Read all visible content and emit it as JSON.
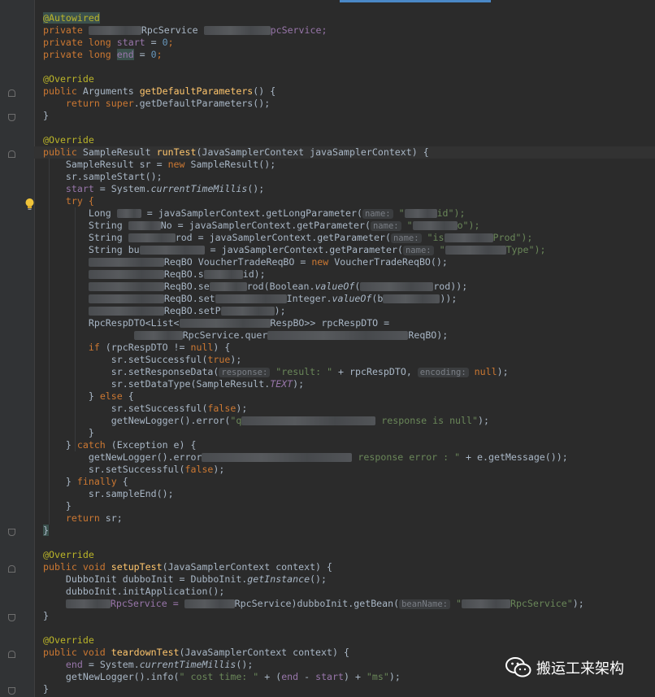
{
  "editor": {
    "background": "#2b2b2b",
    "gutter_bg": "#313335",
    "accent": "#4a88c7"
  },
  "code": {
    "l1": "@Autowired",
    "l2a": "private ",
    "l2b": "RpcService ",
    "l2c": "pcService;",
    "l3a": "private long ",
    "l3b": "start",
    "l3c": " = ",
    "l3d": "0",
    "l3e": ";",
    "l4a": "private long ",
    "l4b": "end",
    "l4c": " = ",
    "l4d": "0",
    "l4e": ";",
    "l6": "@Override",
    "l7a": "public ",
    "l7b": "Arguments ",
    "l7c": "getDefaultParameters",
    "l7d": "() {",
    "l8a": "return super",
    "l8b": ".getDefaultParameters();",
    "l9": "}",
    "l11": "@Override",
    "l12a": "public ",
    "l12b": "SampleResult ",
    "l12c": "runTest",
    "l12d": "(JavaSamplerContext javaSamplerContext) {",
    "l13a": "SampleResult sr = ",
    "l13b": "new ",
    "l13c": "SampleResult();",
    "l14": "sr.sampleStart();",
    "l15a": "start",
    "l15b": " = System.",
    "l15c": "currentTimeMillis",
    "l15d": "();",
    "l16": "try {",
    "l17a": "Long ",
    "l17b": " = javaSamplerContext.getLongParameter(",
    "l17h": "name:",
    "l17c": " \"",
    "l17d": "id\");",
    "l18a": "String ",
    "l18b": "No = javaSamplerContext.getParameter(",
    "l18h": "name:",
    "l18c": " \"",
    "l18d": "o\");",
    "l19a": "String ",
    "l19b": "rod = javaSamplerContext.getParameter(",
    "l19h": "name:",
    "l19c": " \"is",
    "l19d": "Prod\");",
    "l20a": "String bu",
    "l20b": " = javaSamplerContext.getParameter(",
    "l20h": "name:",
    "l20c": " \"",
    "l20d": "Type\");",
    "l21a": "ReqBO VoucherTradeReqBO = ",
    "l21b": "new ",
    "l21c": "VoucherTradeReqBO();",
    "l22a": "ReqBO.s",
    "l22b": "id);",
    "l23a": "ReqBO.se",
    "l23b": "rod(Boolean.",
    "l23c": "valueOf",
    "l23d": "(",
    "l23e": "rod));",
    "l24a": "ReqBO.set",
    "l24b": "Integer.",
    "l24c": "valueOf",
    "l24d": "(b",
    "l24e": "));",
    "l25a": "ReqBO.setP",
    "l25b": ");",
    "l26a": "RpcRespDTO<List<",
    "l26b": "RespBO>> rpcRespDTO =",
    "l27a": "RpcService.quer",
    "l27b": "ReqBO);",
    "l28a": "if ",
    "l28b": "(rpcRespDTO != ",
    "l28c": "null",
    "l28d": ") {",
    "l29a": "sr.setSuccessful(",
    "l29b": "true",
    "l29c": ");",
    "l30a": "sr.setResponseData(",
    "l30h": "response:",
    "l30b": " \"result: \"",
    "l30c": " + rpcRespDTO, ",
    "l30h2": "encoding:",
    "l30d": " null",
    "l30e": ");",
    "l31a": "sr.setDataType(SampleResult.",
    "l31b": "TEXT",
    "l31c": ");",
    "l32a": "} ",
    "l32b": "else ",
    "l32c": "{",
    "l33a": "sr.setSuccessful(",
    "l33b": "false",
    "l33c": ");",
    "l34a": "getNewLogger().error(",
    "l34b": "\"q",
    "l34c": " response is null\"",
    "l34d": ");",
    "l35": "}",
    "l36a": "} ",
    "l36b": "catch ",
    "l36c": "(Exception e) {",
    "l37a": "getNewLogger().error",
    "l37b": " response error : \"",
    "l37c": " + e.getMessage());",
    "l38a": "sr.setSuccessful(",
    "l38b": "false",
    "l38c": ");",
    "l39a": "} ",
    "l39b": "finally ",
    "l39c": "{",
    "l40": "sr.sampleEnd();",
    "l41": "}",
    "l42a": "return ",
    "l42b": "sr;",
    "l43": "}",
    "l45": "@Override",
    "l46a": "public void ",
    "l46b": "setupTest",
    "l46c": "(JavaSamplerContext context) {",
    "l47a": "DubboInit dubboInit = DubboInit.",
    "l47b": "getInstance",
    "l47c": "();",
    "l48": "dubboInit.initApplication();",
    "l49a": "RpcService = ",
    "l49b": "RpcService)dubboInit.getBean(",
    "l49h": "beanName:",
    "l49c": " \"",
    "l49d": "RpcService\"",
    "l49e": ");",
    "l50": "}",
    "l52": "@Override",
    "l53a": "public void ",
    "l53b": "teardownTest",
    "l53c": "(JavaSamplerContext context) {",
    "l54a": "end",
    "l54b": " = System.",
    "l54c": "currentTimeMillis",
    "l54d": "();",
    "l55a": "getNewLogger().info(",
    "l55b": "\" cost time: \"",
    "l55c": " + (",
    "l55d": "end",
    "l55e": " - ",
    "l55f": "start",
    "l55g": ") + ",
    "l55h": "\"ms\"",
    "l55i": ");",
    "l56": "}"
  },
  "icons": {
    "bulb": "lightbulb-icon",
    "fold": "fold-marker-icon",
    "wechat": "wechat-logo-icon"
  },
  "watermark": {
    "text": "搬运工来架构"
  }
}
